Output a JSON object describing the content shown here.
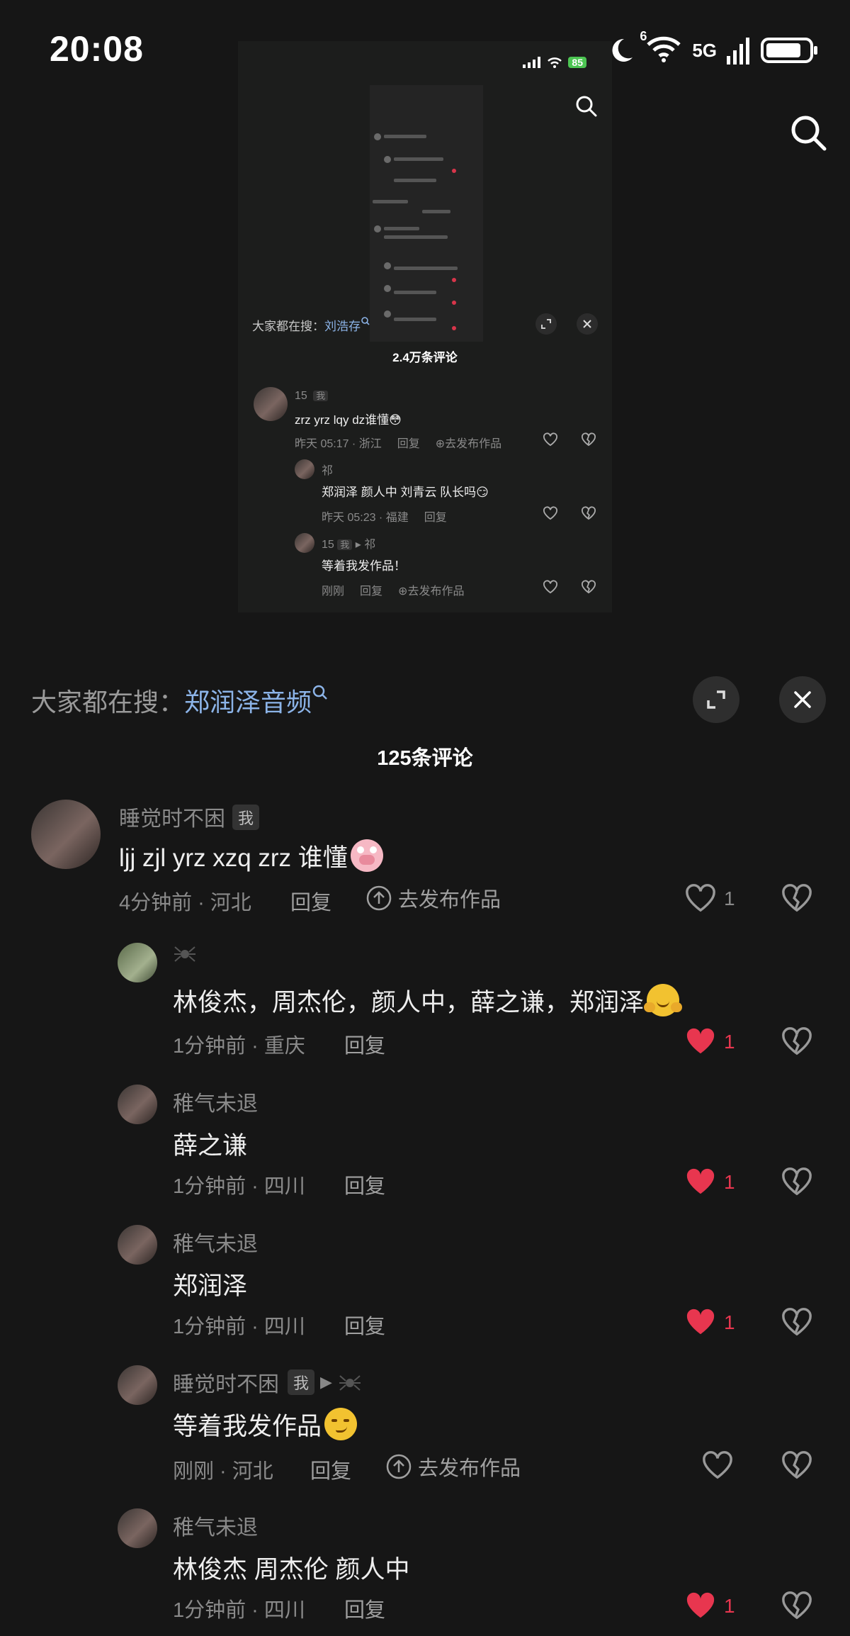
{
  "status_bar": {
    "time": "20:08",
    "network": "5G",
    "wifi_badge": "6"
  },
  "embedded_screenshot": {
    "status_battery": "85",
    "search_hint_prefix": "大家都在搜：",
    "search_hint_keyword": "刘浩存",
    "comment_count": "2.4万条评论",
    "comments": [
      {
        "name": "15",
        "badge": "我",
        "text": "zrz yrz lqy dz谁懂😳",
        "meta": "昨天 05:17 · 浙江",
        "reply": "回复",
        "publish": "去发布作品"
      },
      {
        "name": "祁",
        "text": "郑润泽 颜人中 刘青云 队长吗😏",
        "meta": "昨天 05:23 · 福建",
        "reply": "回复"
      },
      {
        "name": "15",
        "badge": "我",
        "reply_to": "祁",
        "text": "等着我发作品！",
        "meta": "刚刚",
        "reply": "回复",
        "publish": "去发布作品"
      }
    ]
  },
  "search_suggestion": {
    "prefix": "大家都在搜：",
    "keyword": "郑润泽音频"
  },
  "comment_count": "125条评论",
  "comments": [
    {
      "name": "睡觉时不困",
      "badge": "我",
      "text": "ljj zjl yrz xzq zrz 谁懂",
      "emoji": "pig-face",
      "time": "4分钟前 · 河北",
      "reply": "回复",
      "publish": "去发布作品",
      "likes": "1",
      "liked": false
    },
    {
      "name": "",
      "name_icon": "spider-icon",
      "text": "林俊杰，周杰伦，颜人中，薛之谦，郑润泽",
      "emoji": "hugging-face",
      "time": "1分钟前 · 重庆",
      "reply": "回复",
      "likes": "1",
      "liked": true
    },
    {
      "name": "稚气未退",
      "text": "薛之谦",
      "time": "1分钟前 · 四川",
      "reply": "回复",
      "likes": "1",
      "liked": true
    },
    {
      "name": "稚气未退",
      "text": "郑润泽",
      "time": "1分钟前 · 四川",
      "reply": "回复",
      "likes": "1",
      "liked": true
    },
    {
      "name": "睡觉时不困",
      "badge": "我",
      "reply_to_icon": "spider-icon",
      "text": "等着我发作品",
      "emoji": "smirk-face",
      "time": "刚刚 · 河北",
      "reply": "回复",
      "publish": "去发布作品",
      "likes": "",
      "liked": false
    },
    {
      "name": "稚气未退",
      "text": "林俊杰 周杰伦 颜人中",
      "time": "1分钟前 · 四川",
      "reply": "回复",
      "likes": "1",
      "liked": true
    }
  ],
  "colors": {
    "accent_like": "#e8364f",
    "link": "#8cb4e8",
    "background": "#161616"
  }
}
